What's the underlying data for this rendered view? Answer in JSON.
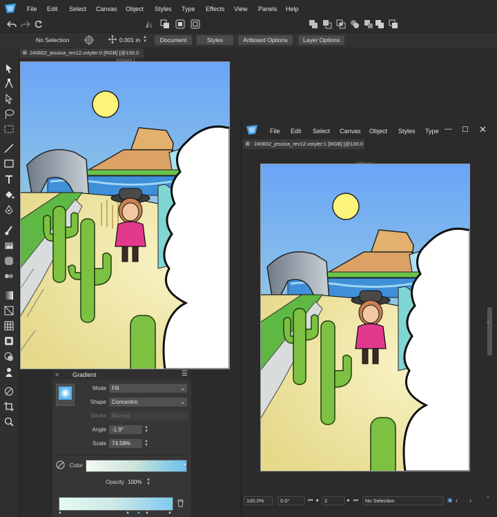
{
  "app": {
    "menu": [
      "File",
      "Edit",
      "Select",
      "Canvas",
      "Object",
      "Styles",
      "Type",
      "Effects",
      "View",
      "Panels",
      "Help"
    ]
  },
  "context_bar": {
    "selection": "No Selection",
    "offset_value": "0.001 in",
    "buttons": [
      "Document",
      "Styles",
      "Artboard Options",
      "Layer Options"
    ]
  },
  "doc1": {
    "tab_title": "240602_jessica_rev12.vstyler:0 [RGB] [@100.0",
    "artboard_label": "Artboard 1"
  },
  "second_window": {
    "menu": [
      "File",
      "Edit",
      "Select",
      "Canvas",
      "Object",
      "Styles",
      "Type"
    ],
    "tab_title": "240602_jessica_rev12.vstyler:1 [RGB] [@100.0",
    "artboard_label": "Artboard 1",
    "status": {
      "zoom": "100.0%",
      "rotation": "0.0°",
      "page": "2",
      "selection": "No Selection"
    }
  },
  "gradient_panel": {
    "title": "Gradient",
    "mode_label": "Mode",
    "mode_value": "Fill",
    "shape_label": "Shape",
    "shape_value": "Concentric",
    "stroke_label": "Stroke",
    "stroke_value": "Normal",
    "angle_label": "Angle",
    "angle_value": "-1.9°",
    "scale_label": "Scale",
    "scale_value": "74.58%",
    "color_label": "Color",
    "opacity_label": "Opacity",
    "opacity_value": "100%"
  },
  "colors": {
    "accent": "#4a9de0",
    "sky_top": "#6fa8f5",
    "sky_bottom": "#b6ecd6",
    "sand": "#f0e7ad",
    "cactus": "#7cc142",
    "pink_jacket": "#e2388c"
  }
}
